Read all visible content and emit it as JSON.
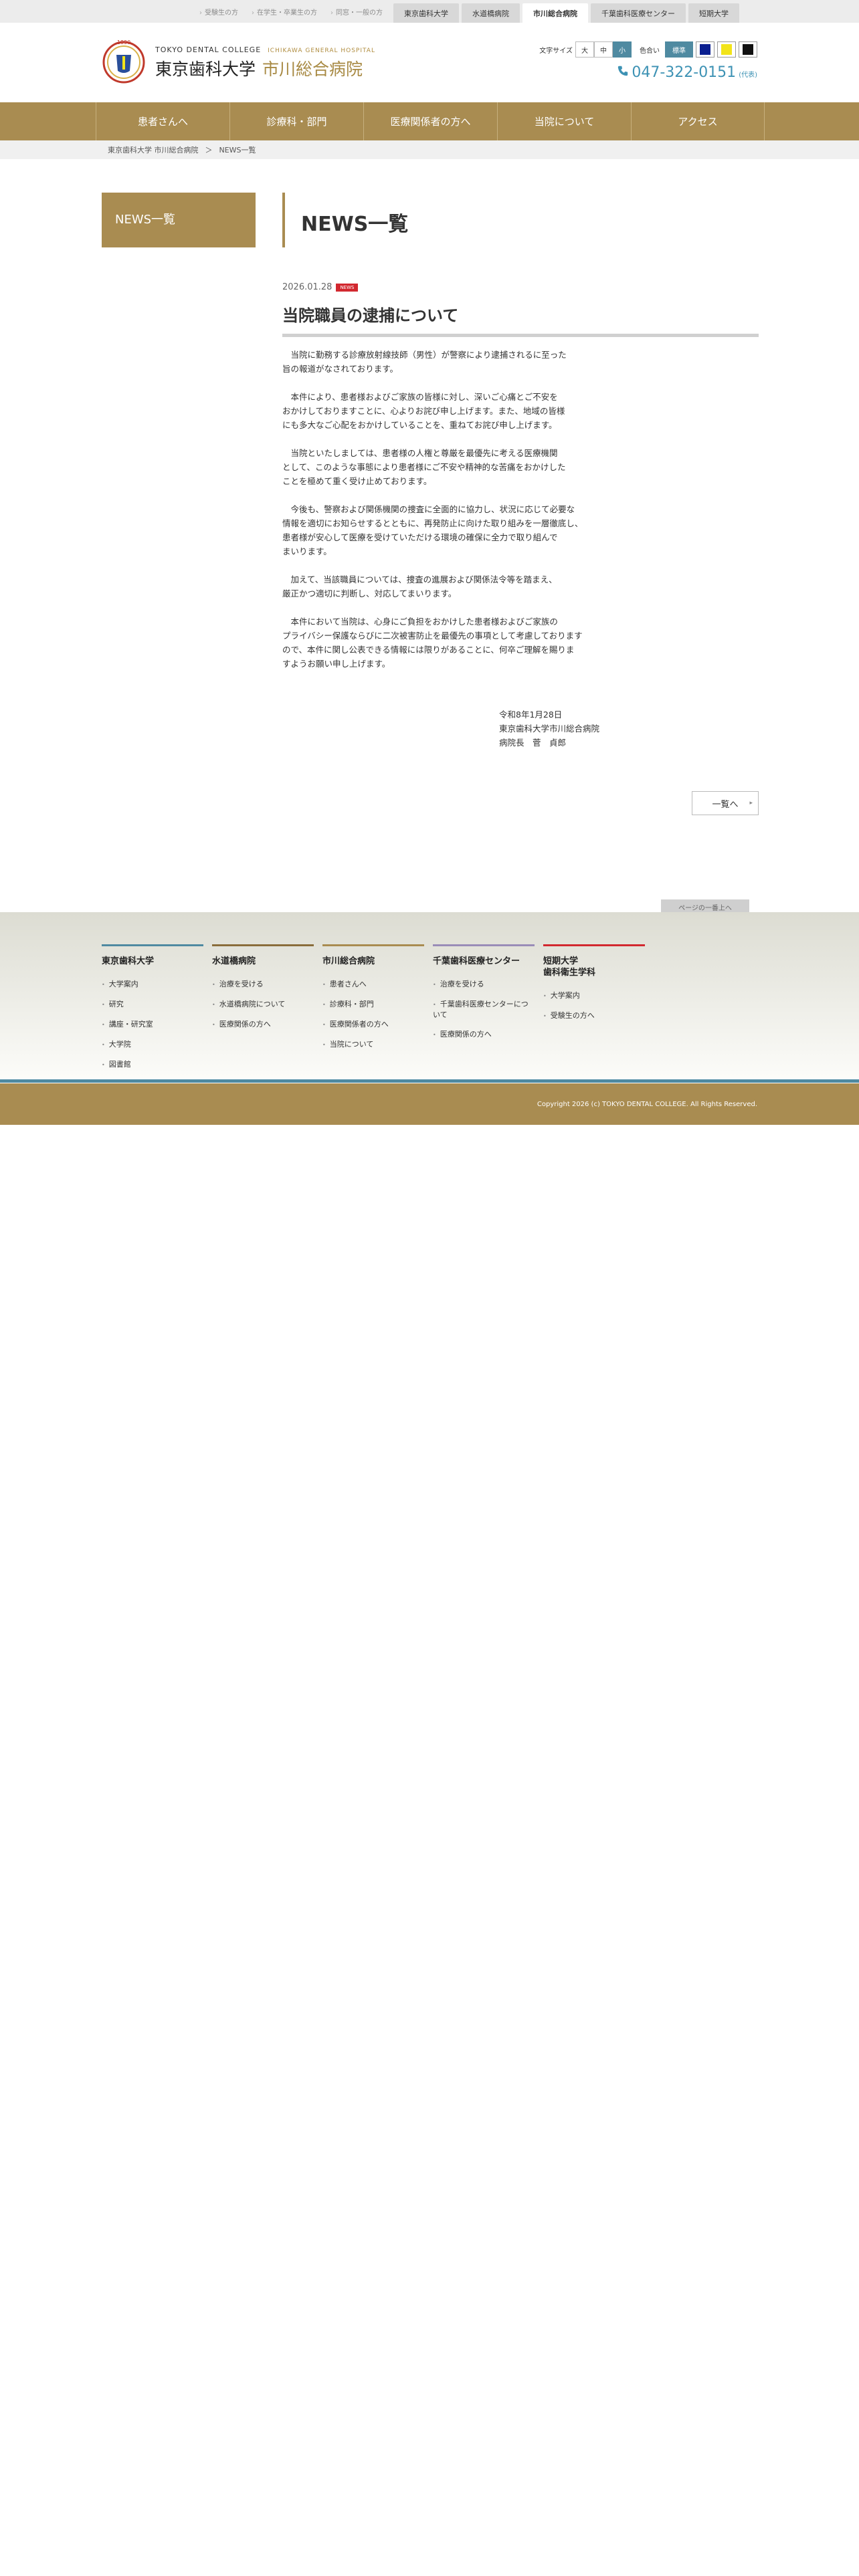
{
  "topbar": {
    "links": [
      "受験生の方",
      "在学生・卒業生の方",
      "同窓・一般の方"
    ],
    "tabs": [
      "東京歯科大学",
      "水道橋病院",
      "市川総合病院",
      "千葉歯科医療センター",
      "短期大学"
    ],
    "active_tab": "市川総合病院"
  },
  "header": {
    "logo_en": "TOKYO DENTAL COLLEGE",
    "logo_en_sub": "ICHIKAWA GENERAL HOSPITAL",
    "logo_jp": "東京歯科大学",
    "logo_jp_sub": "市川総合病院",
    "font_size_label": "文字サイズ",
    "font_sizes": [
      "大",
      "中",
      "小"
    ],
    "color_label": "色合い",
    "color_std": "標準",
    "color_swatches": [
      "#0a1f8f",
      "#f2e41a",
      "#111111"
    ],
    "phone": "047-322-0151",
    "phone_note": "(代表)"
  },
  "nav": [
    "患者さんへ",
    "診療科・部門",
    "医療関係者の方へ",
    "当院について",
    "アクセス"
  ],
  "breadcrumb": [
    "東京歯科大学 市川総合病院",
    "＞",
    "NEWS一覧"
  ],
  "sidebar": {
    "title": "NEWS一覧"
  },
  "main": {
    "page_title": "NEWS一覧",
    "date": "2026.01.28",
    "badge": "NEWS",
    "article_title": "当院職員の逮捕について",
    "paragraphs": [
      "　当院に勤務する診療放射線技師（男性）が警察により逮捕されるに至った\n旨の報道がなされております。",
      "　本件により、患者様およびご家族の皆様に対し、深いご心痛とご不安を\nおかけしておりますことに、心よりお詫び申し上げます。また、地域の皆様\nにも多大なご心配をおかけしていることを、重ねてお詫び申し上げます。",
      "　当院といたしましては、患者様の人権と尊厳を最優先に考える医療機関\nとして、このような事態により患者様にご不安や精神的な苦痛をおかけした\nことを極めて重く受け止めております。",
      "　今後も、警察および関係機関の捜査に全面的に協力し、状況に応じて必要な\n情報を適切にお知らせするとともに、再発防止に向けた取り組みを一層徹底し、\n患者様が安心して医療を受けていただける環境の確保に全力で取り組んで\nまいります。",
      "　加えて、当該職員については、捜査の進展および関係法令等を踏まえ、\n厳正かつ適切に判断し、対応してまいります。",
      "　本件において当院は、心身にご負担をおかけした患者様およびご家族の\nプライバシー保護ならびに二次被害防止を最優先の事項として考慮しております\nので、本件に関し公表できる情報には限りがあることに、何卒ご理解を賜りま\nすようお願い申し上げます。"
    ],
    "sign": [
      "令和8年1月28日",
      "東京歯科大学市川総合病院",
      "病院長　菅　貞郎"
    ],
    "list_button": "一覧へ"
  },
  "footer": {
    "pagetop": "ページの一番上へ",
    "columns": [
      {
        "head": "東京歯科大学",
        "items": [
          "大学案内",
          "研究",
          "講座・研究室",
          "大学院",
          "図書館"
        ],
        "color": "#4f8aa1"
      },
      {
        "head": "水道橋病院",
        "items": [
          "治療を受ける",
          "水道橋病院について",
          "医療関係の方へ"
        ],
        "color": "#8a6d3b"
      },
      {
        "head": "市川総合病院",
        "items": [
          "患者さんへ",
          "診療科・部門",
          "医療関係者の方へ",
          "当院について"
        ],
        "color": "#a98c51"
      },
      {
        "head": "千葉歯科医療センター",
        "items": [
          "治療を受ける",
          "千葉歯科医療センターについて",
          "医療関係の方へ"
        ],
        "color": "#9a8db8"
      },
      {
        "head": "短期大学\n歯科衛生学科",
        "items": [
          "大学案内",
          "受験生の方へ"
        ],
        "color": "#d2282f"
      }
    ],
    "copyright": "Copyright 2026 (c) TOKYO DENTAL COLLEGE. All Rights Reserved."
  }
}
